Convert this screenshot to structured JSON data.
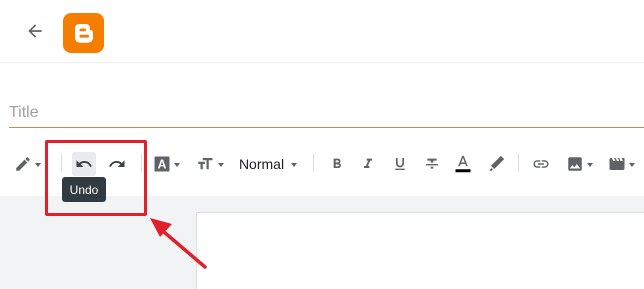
{
  "header": {
    "back_icon": "arrow-left-icon",
    "logo_icon": "blogger-logo-icon",
    "logo_color": "#f57d00"
  },
  "title": {
    "placeholder": "Title",
    "value": ""
  },
  "toolbar": {
    "edit_mode_icon": "pencil-icon",
    "undo_icon": "undo-icon",
    "redo_icon": "redo-icon",
    "font_icon": "font-icon",
    "text_size_icon": "text-size-icon",
    "paragraph_format": "Normal",
    "bold_icon": "bold-icon",
    "italic_icon": "italic-icon",
    "underline_icon": "underline-icon",
    "strikethrough_icon": "strikethrough-icon",
    "text_color_icon": "text-color-icon",
    "highlight_icon": "highlight-icon",
    "link_icon": "link-icon",
    "image_icon": "image-icon",
    "video_icon": "video-icon"
  },
  "tooltip": {
    "text": "Undo"
  },
  "annotation": {
    "color": "#e0202a"
  }
}
